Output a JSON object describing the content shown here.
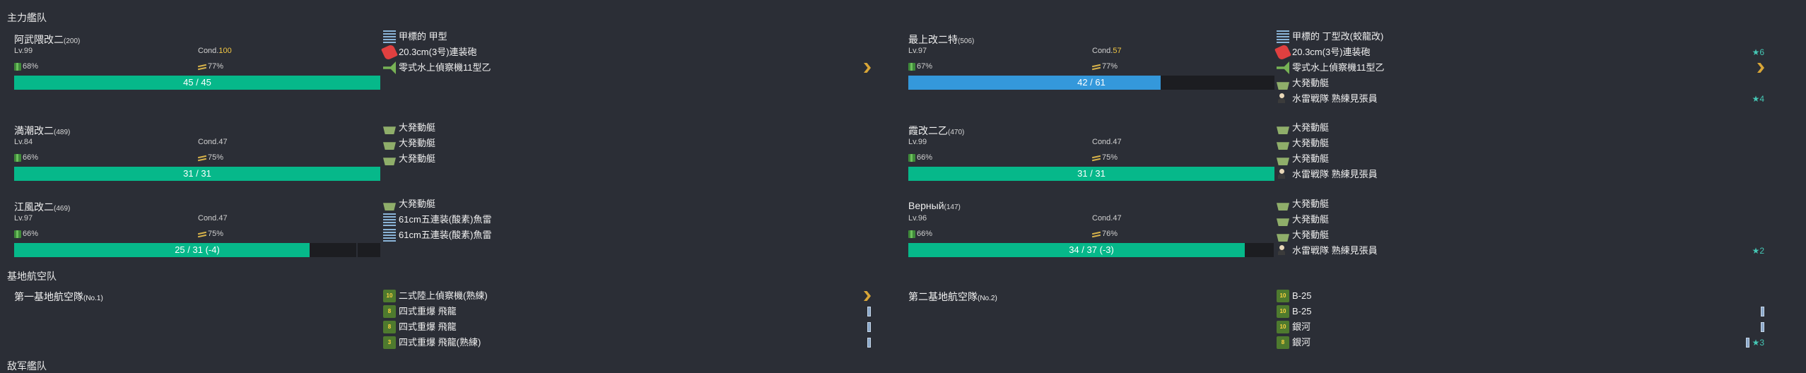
{
  "sections": {
    "main_fleet": "主力艦队",
    "land_base": "基地航空队",
    "enemy_fleet": "敌军艦队"
  },
  "colors": {
    "background": "#2b2e36",
    "hp_green": "#06b88a",
    "hp_blue": "#3498db",
    "cond_yellow": "#f2c744",
    "star_teal": "#45c7b5",
    "chevron_gold": "#d9a637"
  },
  "ships": [
    {
      "name": "阿武隈改二",
      "id": "(200)",
      "lv": "Lv.99",
      "cond_label": "Cond.",
      "cond": "100",
      "cond_color": "yellow",
      "fuel": "68%",
      "ammo": "77%",
      "hp_text": "45 / 45",
      "hp_fraction": 1.0,
      "bar_color": "green",
      "equips": [
        {
          "icon": "radar-icon",
          "name": "甲標的 甲型"
        },
        {
          "icon": "main-gun-icon",
          "name": "20.3cm(3号)連装砲"
        },
        {
          "icon": "seaplane-icon",
          "name": "零式水上偵察機11型乙",
          "chevron": true
        }
      ]
    },
    {
      "name": "最上改二特",
      "id": "(506)",
      "lv": "Lv.97",
      "cond_label": "Cond.",
      "cond": "57",
      "cond_color": "yellow",
      "fuel": "67%",
      "ammo": "77%",
      "hp_text": "42 / 61",
      "hp_fraction": 0.6885,
      "bar_color": "blue",
      "equips": [
        {
          "icon": "radar-icon",
          "name": "甲標的 丁型改(蛟龍改)"
        },
        {
          "icon": "main-gun-icon",
          "name": "20.3cm(3号)連装砲",
          "star": "★6"
        },
        {
          "icon": "seaplane-icon",
          "name": "零式水上偵察機11型乙",
          "chevron": true
        },
        {
          "icon": "landing-craft-icon",
          "name": "大発動艇"
        },
        {
          "icon": "personnel-icon",
          "name": "水雷戦隊 熟練見張員",
          "star": "★4"
        }
      ]
    },
    {
      "name": "満潮改二",
      "id": "(489)",
      "lv": "Lv.84",
      "cond_label": "Cond.",
      "cond": "47",
      "cond_color": "normal",
      "fuel": "66%",
      "ammo": "75%",
      "hp_text": "31 / 31",
      "hp_fraction": 1.0,
      "bar_color": "green",
      "equips": [
        {
          "icon": "landing-craft-icon",
          "name": "大発動艇"
        },
        {
          "icon": "landing-craft-icon",
          "name": "大発動艇"
        },
        {
          "icon": "landing-craft-icon",
          "name": "大発動艇"
        }
      ]
    },
    {
      "name": "霞改二乙",
      "id": "(470)",
      "lv": "Lv.99",
      "cond_label": "Cond.",
      "cond": "47",
      "cond_color": "normal",
      "fuel": "66%",
      "ammo": "75%",
      "hp_text": "31 / 31",
      "hp_fraction": 1.0,
      "bar_color": "green",
      "equips": [
        {
          "icon": "landing-craft-icon",
          "name": "大発動艇"
        },
        {
          "icon": "landing-craft-icon",
          "name": "大発動艇"
        },
        {
          "icon": "landing-craft-icon",
          "name": "大発動艇"
        },
        {
          "icon": "personnel-icon",
          "name": "水雷戦隊 熟練見張員"
        }
      ]
    },
    {
      "name": "江風改二",
      "id": "(469)",
      "lv": "Lv.97",
      "cond_label": "Cond.",
      "cond": "47",
      "cond_color": "normal",
      "fuel": "66%",
      "ammo": "75%",
      "hp_text": "25 / 31 (-4)",
      "hp_fraction": 0.8065,
      "damage_fraction": 0.129,
      "bar_color": "green",
      "equips": [
        {
          "icon": "landing-craft-icon",
          "name": "大発動艇"
        },
        {
          "icon": "torpedo-icon",
          "name": "61cm五連装(酸素)魚雷"
        },
        {
          "icon": "torpedo-icon",
          "name": "61cm五連装(酸素)魚雷"
        }
      ]
    },
    {
      "name": "Верный",
      "id": "(147)",
      "lv": "Lv.96",
      "cond_label": "Cond.",
      "cond": "47",
      "cond_color": "normal",
      "fuel": "66%",
      "ammo": "76%",
      "hp_text": "34 / 37 (-3)",
      "hp_fraction": 0.919,
      "damage_fraction": 0.081,
      "bar_color": "green",
      "equips": [
        {
          "icon": "landing-craft-icon",
          "name": "大発動艇"
        },
        {
          "icon": "landing-craft-icon",
          "name": "大発動艇"
        },
        {
          "icon": "landing-craft-icon",
          "name": "大発動艇"
        },
        {
          "icon": "personnel-icon",
          "name": "水雷戦隊 熟練見張員",
          "star": "★2"
        }
      ]
    }
  ],
  "land_bases": [
    {
      "name": "第一基地航空隊",
      "id": "(No.1)",
      "planes": [
        {
          "count": "10",
          "name": "二式陸上偵察機(熟練)",
          "proficiency": "chevron"
        },
        {
          "count": "8",
          "name": "四式重爆 飛龍",
          "proficiency": "bar"
        },
        {
          "count": "8",
          "name": "四式重爆 飛龍",
          "proficiency": "bar"
        },
        {
          "count": "3",
          "name": "四式重爆 飛龍(熟練)",
          "proficiency": "bar"
        }
      ]
    },
    {
      "name": "第二基地航空隊",
      "id": "(No.2)",
      "planes": [
        {
          "count": "10",
          "name": "B-25",
          "proficiency": ""
        },
        {
          "count": "10",
          "name": "B-25",
          "proficiency": "bar"
        },
        {
          "count": "10",
          "name": "銀河",
          "proficiency": "bar"
        },
        {
          "count": "8",
          "name": "銀河",
          "proficiency": "bar",
          "star": "★3"
        }
      ]
    }
  ]
}
